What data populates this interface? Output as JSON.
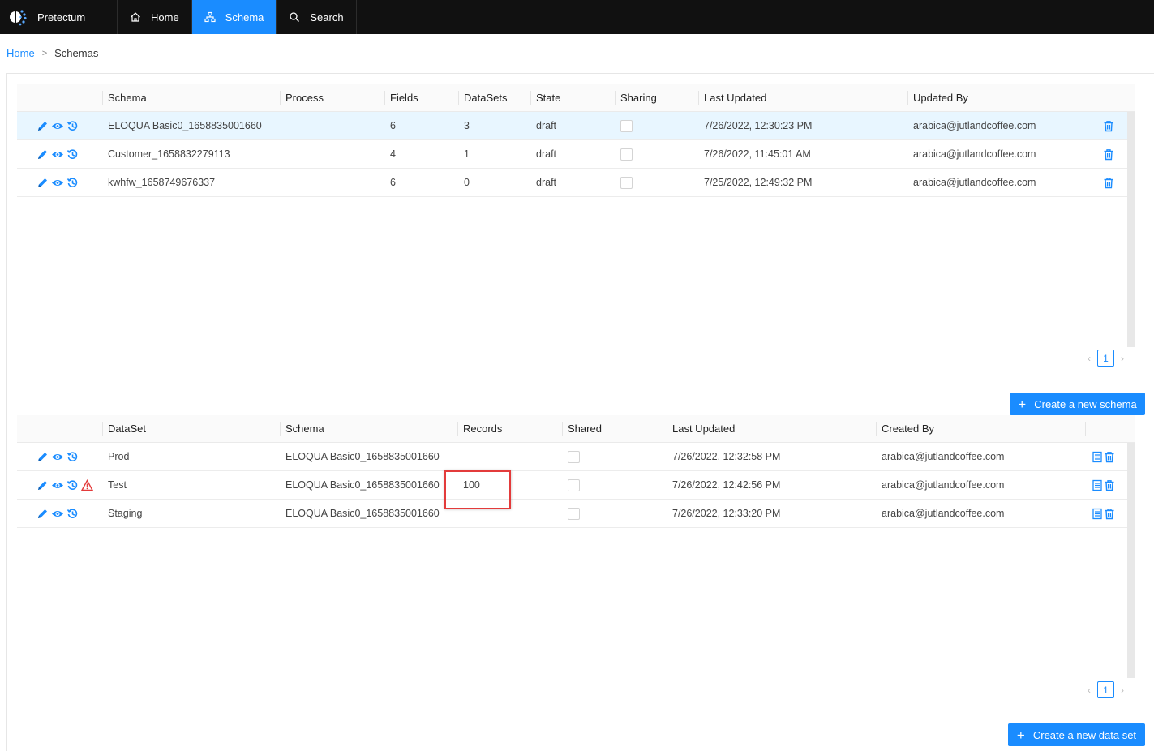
{
  "app": {
    "brand": "Pretectum"
  },
  "nav": [
    {
      "label": "Home",
      "icon": "home-icon"
    },
    {
      "label": "Schema",
      "icon": "schema-icon",
      "active": true
    },
    {
      "label": "Search",
      "icon": "search-icon"
    }
  ],
  "breadcrumb": {
    "home": "Home",
    "separator": ">",
    "current": "Schemas"
  },
  "schemas": {
    "columns": [
      "Schema",
      "Process",
      "Fields",
      "DataSets",
      "State",
      "Sharing",
      "Last Updated",
      "Updated By"
    ],
    "rows": [
      {
        "schema": "ELOQUA Basic0_1658835001660",
        "process": "",
        "fields": "6",
        "datasets": "3",
        "state": "draft",
        "sharing": false,
        "last_updated": "7/26/2022, 12:30:23 PM",
        "updated_by": "arabica@jutlandcoffee.com"
      },
      {
        "schema": "Customer_1658832279113",
        "process": "",
        "fields": "4",
        "datasets": "1",
        "state": "draft",
        "sharing": false,
        "last_updated": "7/26/2022, 11:45:01 AM",
        "updated_by": "arabica@jutlandcoffee.com"
      },
      {
        "schema": "kwhfw_1658749676337",
        "process": "",
        "fields": "6",
        "datasets": "0",
        "state": "draft",
        "sharing": false,
        "last_updated": "7/25/2022, 12:49:32 PM",
        "updated_by": "arabica@jutlandcoffee.com"
      }
    ],
    "page": "1",
    "create_button": "Create a new schema"
  },
  "datasets": {
    "columns": [
      "DataSet",
      "Schema",
      "Records",
      "Shared",
      "Last Updated",
      "Created By"
    ],
    "rows": [
      {
        "dataset": "Prod",
        "schema": "ELOQUA Basic0_1658835001660",
        "records": "",
        "shared": false,
        "last_updated": "7/26/2022, 12:32:58 PM",
        "created_by": "arabica@jutlandcoffee.com",
        "warning": false
      },
      {
        "dataset": "Test",
        "schema": "ELOQUA Basic0_1658835001660",
        "records": "100",
        "shared": false,
        "last_updated": "7/26/2022, 12:42:56 PM",
        "created_by": "arabica@jutlandcoffee.com",
        "warning": true
      },
      {
        "dataset": "Staging",
        "schema": "ELOQUA Basic0_1658835001660",
        "records": "",
        "shared": false,
        "last_updated": "7/26/2022, 12:33:20 PM",
        "created_by": "arabica@jutlandcoffee.com",
        "warning": false
      }
    ],
    "page": "1",
    "create_button": "Create a new data set"
  },
  "colors": {
    "accent": "#1a8cff",
    "nav_bg": "#111111",
    "warning": "#e33b3b",
    "selected_row": "#e8f6ff"
  }
}
